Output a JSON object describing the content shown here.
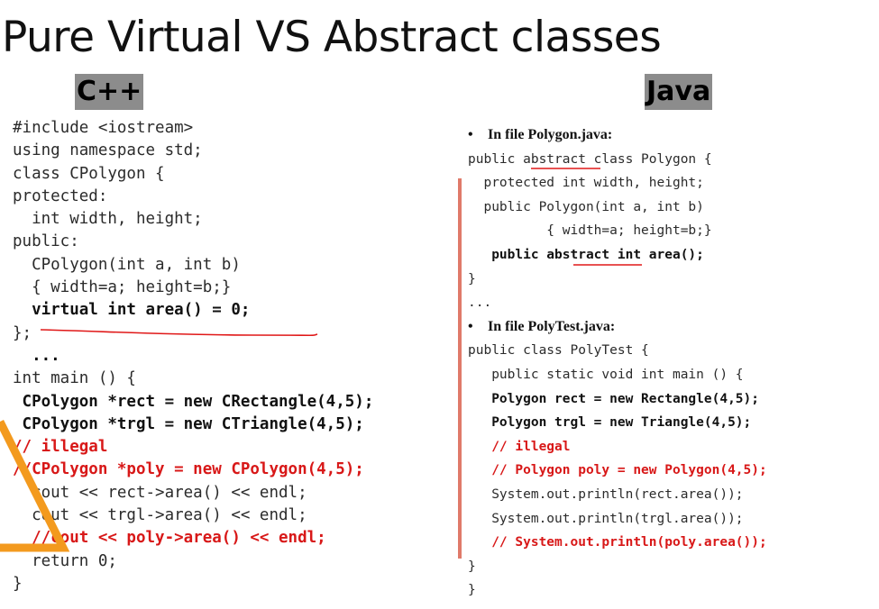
{
  "slide": {
    "title": "Pure Virtual VS Abstract classes",
    "cpp_label": "C++",
    "java_label": "Java"
  },
  "colors": {
    "highlight_red": "#d81818",
    "label_gray": "#8c8c8c",
    "divider_salmon": "#e07a6a",
    "triangle_orange": "#f39a1e"
  },
  "cpp_code": [
    "#include <iostream>",
    "using namespace std;",
    "class CPolygon {",
    "protected:",
    "  int width, height;",
    "public:",
    "  CPolygon(int a, int b)",
    "  { width=a; height=b;}",
    "  virtual int area() = 0;",
    "};",
    "  ...",
    "int main () {",
    " CPolygon *rect = new CRectangle(4,5);",
    " CPolygon *trgl = new CTriangle(4,5);",
    "// illegal",
    "//CPolygon *poly = new CPolygon(4,5);",
    "  cout << rect->area() << endl;",
    "  cout << trgl->area() << endl;",
    "  //cout << poly->area() << endl;",
    "  return 0;",
    "}"
  ],
  "java_code": {
    "file1_heading": "In file Polygon.java:",
    "polygon_class": [
      "public abstract class Polygon {",
      "  protected int width, height;",
      "  public Polygon(int a, int b)",
      "          { width=a; height=b;}",
      "   public abstract int area();",
      "}",
      "..."
    ],
    "file2_heading": "In file PolyTest.java:",
    "polytest_class": [
      "public class PolyTest {",
      "   public static void int main () {",
      "   Polygon rect = new Rectangle(4,5);",
      "   Polygon trgl = new Triangle(4,5);",
      "   // illegal",
      "   // Polygon poly = new Polygon(4,5);",
      "   System.out.println(rect.area());",
      "   System.out.println(trgl.area());",
      "   // System.out.println(poly.area());",
      "}",
      "}"
    ]
  }
}
